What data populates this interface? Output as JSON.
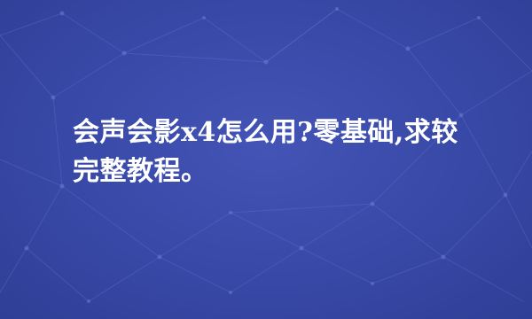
{
  "question": {
    "title": "会声会影x4怎么用?零基础,求较完整教程。"
  },
  "colors": {
    "background": "#3a4aa8",
    "network_lines": "#5a6cc4",
    "network_nodes": "#6a7cd0",
    "text": "#ffffff"
  }
}
